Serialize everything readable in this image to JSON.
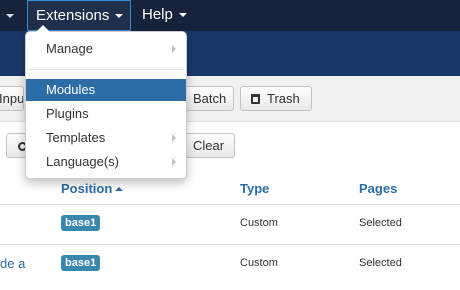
{
  "navbar": {
    "extensions_label": "Extensions",
    "help_label": "Help"
  },
  "toolbar": {
    "partial_button_label": "Inpu",
    "batch_label": "Batch",
    "trash_label": "Trash"
  },
  "filter": {
    "clear_label": "Clear"
  },
  "table": {
    "headers": {
      "position": "Position",
      "type": "Type",
      "pages": "Pages"
    },
    "rows": [
      {
        "title": "",
        "position": "base1",
        "type": "Custom",
        "pages": "Selected"
      },
      {
        "title": "de a",
        "position": "base1",
        "type": "Custom",
        "pages": "Selected"
      }
    ]
  },
  "extensions_menu": {
    "items": [
      {
        "label": "Manage",
        "has_submenu": true
      },
      {
        "label": "Modules",
        "has_submenu": false,
        "active": true
      },
      {
        "label": "Plugins",
        "has_submenu": false
      },
      {
        "label": "Templates",
        "has_submenu": true
      },
      {
        "label": "Language(s)",
        "has_submenu": true
      }
    ]
  },
  "colors": {
    "navbar": "#17233a",
    "subheader": "#1a3867",
    "menu_active": "#2c6ca7",
    "link": "#2a6ea6",
    "badge": "#3a87ad"
  }
}
